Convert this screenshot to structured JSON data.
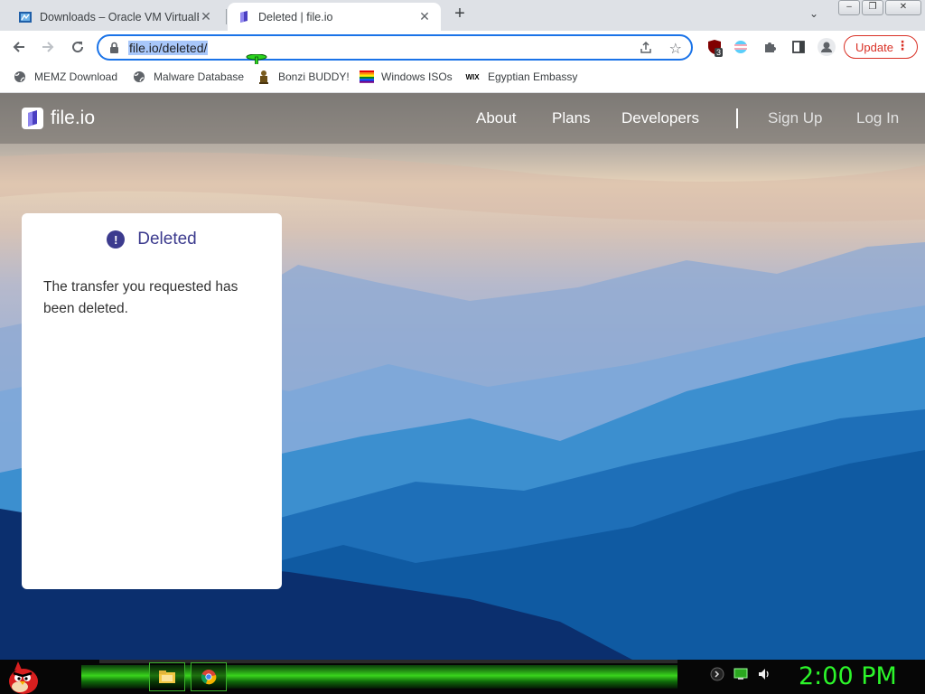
{
  "browser": {
    "tabs": [
      {
        "title": "Downloads – Oracle VM VirtualB",
        "active": false,
        "favicon": "virtualbox-icon"
      },
      {
        "title": "Deleted | file.io",
        "active": true,
        "favicon": "fileio-icon"
      }
    ],
    "new_tab_symbol": "+",
    "tab_menu_symbol": "⌄",
    "window_controls": [
      "–",
      "❐",
      "✕"
    ],
    "address": "file.io/deleted/",
    "extension_badge": "3",
    "update_label": "Update",
    "menu_symbol": "⋮"
  },
  "bookmarks": [
    {
      "label": "MEMZ Download",
      "icon": "globe-icon"
    },
    {
      "label": "Malware Database",
      "icon": "globe-icon"
    },
    {
      "label": "Bonzi BUDDY!",
      "icon": "bonzi-icon"
    },
    {
      "label": "Windows ISOs",
      "icon": "windows-flag-icon"
    },
    {
      "label": "Egyptian Embassy",
      "icon": "wix-icon"
    }
  ],
  "site": {
    "logo_text": "file.io",
    "nav": [
      "About",
      "Plans",
      "Developers"
    ],
    "auth": [
      "Sign Up",
      "Log In"
    ],
    "card": {
      "alert_symbol": "!",
      "title": "Deleted",
      "message": "The transfer you requested has been deleted."
    }
  },
  "taskbar": {
    "clock": "2:00 PM",
    "wix_label": "WIX"
  },
  "colors": {
    "accent": "#1a73e8",
    "card_title": "#3c3b8e",
    "update": "#d93025",
    "clock": "#2cf52a"
  }
}
